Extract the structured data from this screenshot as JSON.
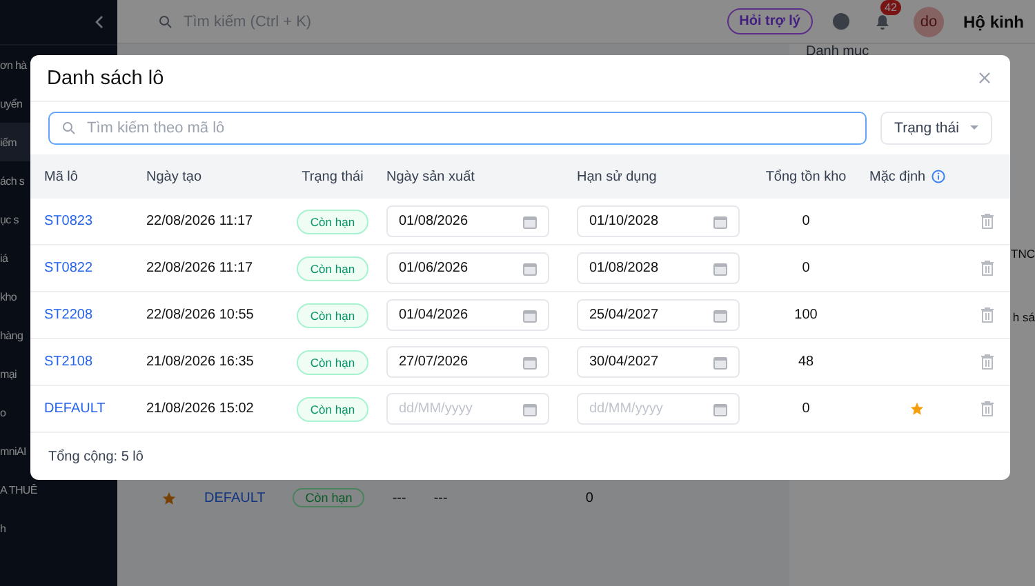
{
  "background": {
    "sidebar_items": [
      {
        "label": "ơn hà",
        "selected": false
      },
      {
        "label": "uyển",
        "selected": false
      },
      {
        "label": "iếm",
        "selected": true
      },
      {
        "label": "ách s",
        "selected": false
      },
      {
        "label": "ục s",
        "selected": false
      },
      {
        "label": "iá",
        "selected": false
      },
      {
        "label": "kho",
        "selected": false
      },
      {
        "label": "hàng",
        "selected": false
      },
      {
        "label": "mại",
        "selected": false
      },
      {
        "label": "o",
        "selected": false
      },
      {
        "label": "mniAI",
        "selected": false
      },
      {
        "label": "A THUÊ",
        "selected": false
      },
      {
        "label": "h",
        "selected": false
      }
    ],
    "search_placeholder": "Tìm kiếm (Ctrl + K)",
    "assistant_button": "Hỏi trợ lý",
    "notification_count": "42",
    "avatar": "do",
    "store_name": "Hộ kinh",
    "panel_label": "Danh mục",
    "panel_fragments": [
      "TNC",
      "h sá"
    ],
    "row": {
      "code": "DEFAULT",
      "status": "Còn hạn",
      "column_3": "---",
      "column_4": "---",
      "stock": "0"
    }
  },
  "dialog": {
    "title": "Danh sách lô",
    "search_placeholder": "Tìm kiếm theo mã lô",
    "status_filter": "Trạng thái",
    "columns": [
      "Mã lô",
      "Ngày tạo",
      "Trạng thái",
      "Ngày sản xuất",
      "Hạn sử dụng",
      "Tổng tồn kho",
      "Mặc định"
    ],
    "rows": [
      {
        "code": "ST0823",
        "created": "22/08/2026 11:17",
        "status": "Còn hạn",
        "manufactured": {
          "value": "01/08/2026"
        },
        "expires": {
          "value": "01/10/2028"
        },
        "stock": "0",
        "default": false
      },
      {
        "code": "ST0822",
        "created": "22/08/2026 11:17",
        "status": "Còn hạn",
        "manufactured": {
          "value": "01/06/2026"
        },
        "expires": {
          "value": "01/08/2028"
        },
        "stock": "0",
        "default": false
      },
      {
        "code": "ST2208",
        "created": "22/08/2026 10:55",
        "status": "Còn hạn",
        "manufactured": {
          "value": "01/04/2026"
        },
        "expires": {
          "value": "25/04/2027"
        },
        "stock": "100",
        "default": false
      },
      {
        "code": "ST2108",
        "created": "21/08/2026 16:35",
        "status": "Còn hạn",
        "manufactured": {
          "value": "27/07/2026"
        },
        "expires": {
          "value": "30/04/2027"
        },
        "stock": "48",
        "default": false
      },
      {
        "code": "DEFAULT",
        "created": "21/08/2026 15:02",
        "status": "Còn hạn",
        "manufactured": {
          "placeholder": "dd/MM/yyyy"
        },
        "expires": {
          "placeholder": "dd/MM/yyyy"
        },
        "stock": "0",
        "default": true
      }
    ],
    "footer": "Tổng cộng: 5 lô"
  }
}
